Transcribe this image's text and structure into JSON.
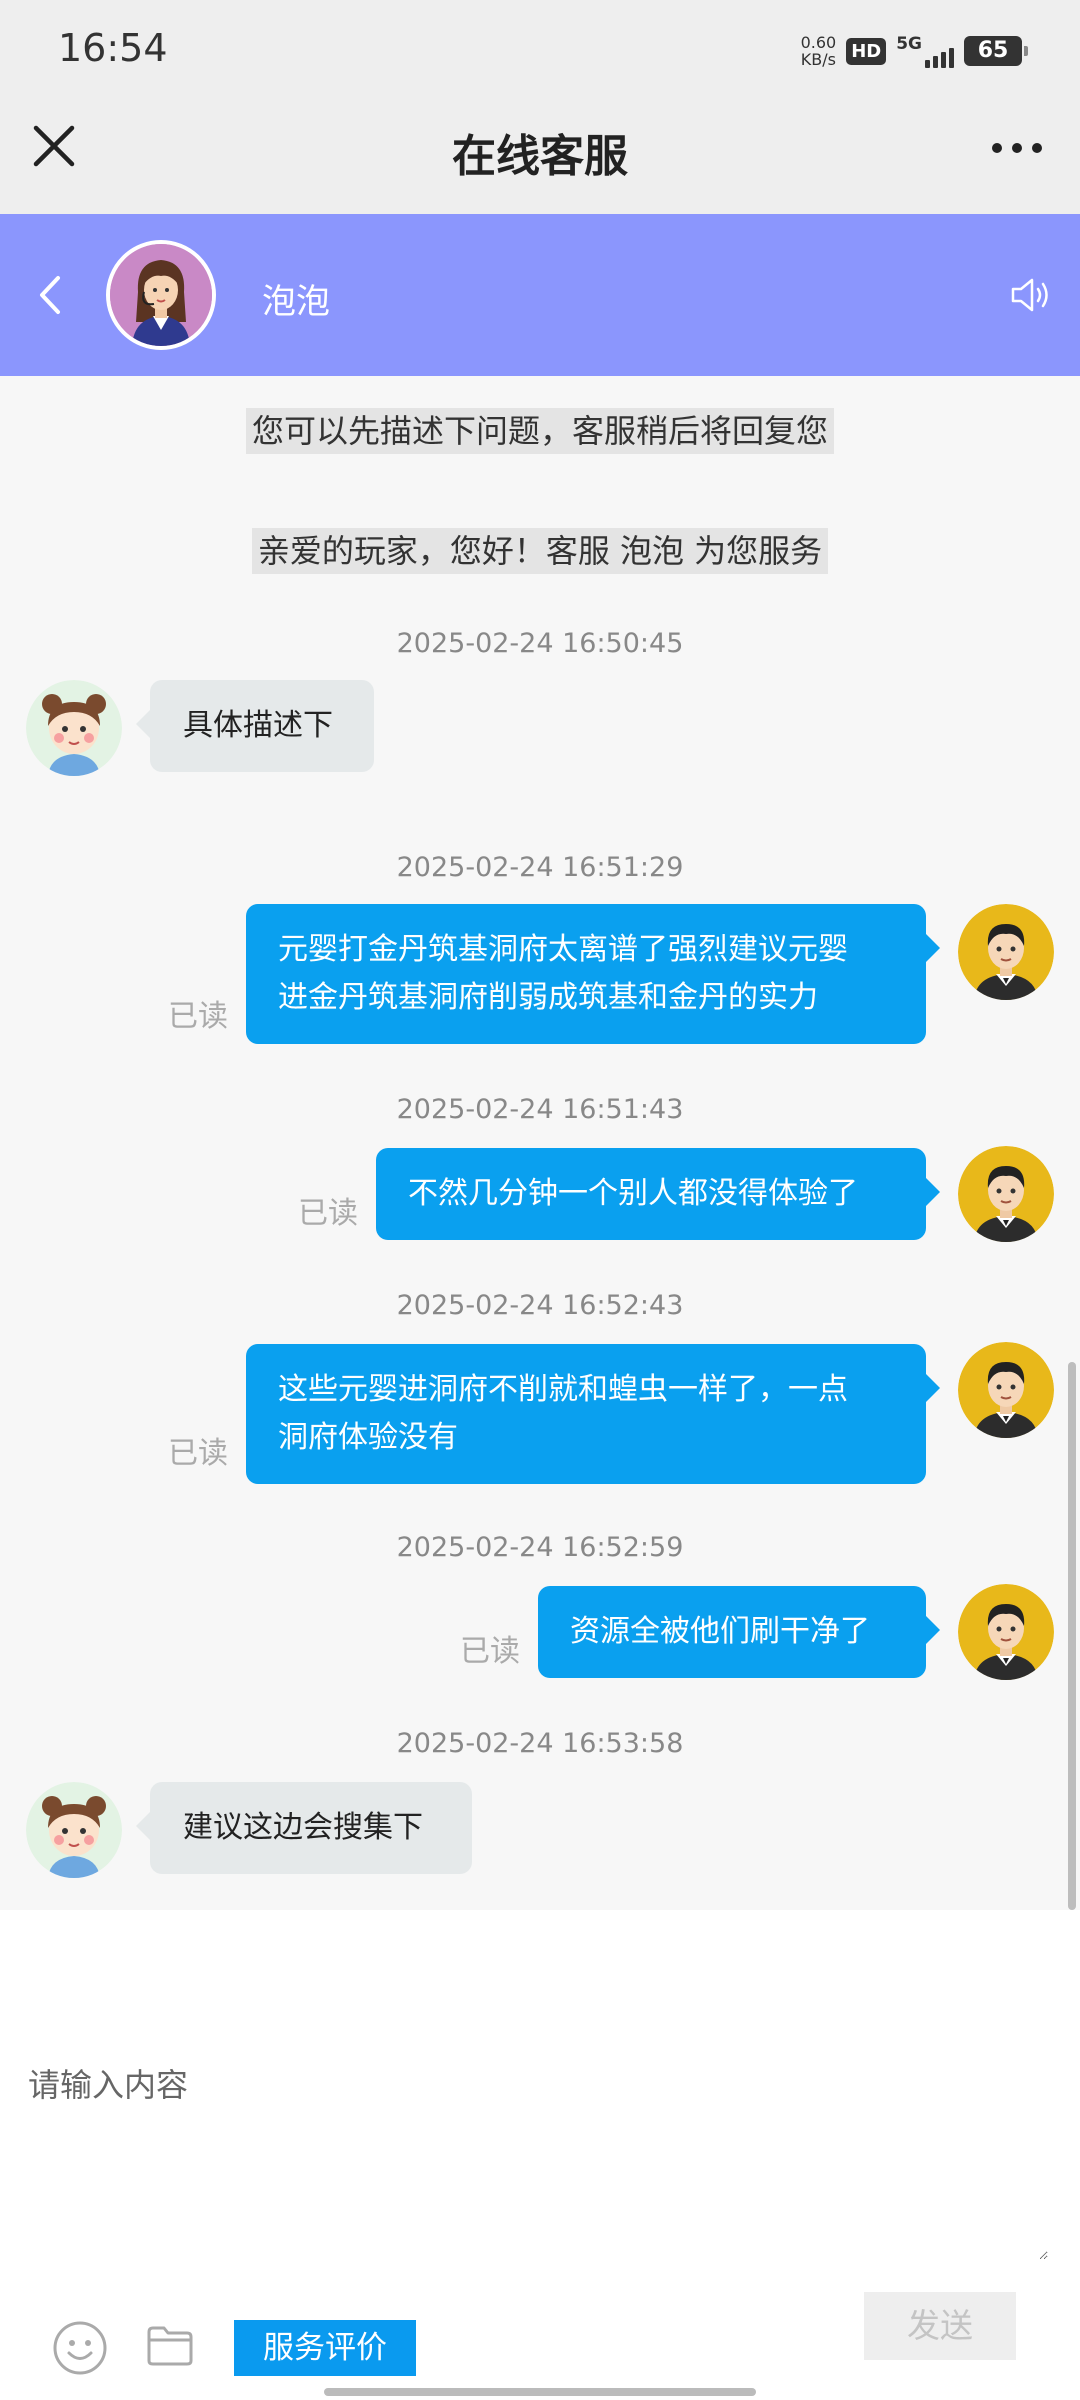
{
  "status_bar": {
    "time": "16:54",
    "net_speed_value": "0.60",
    "net_speed_unit": "KB/s",
    "hd": "HD",
    "network": "5G",
    "battery": "65"
  },
  "title_bar": {
    "title": "在线客服",
    "close_icon": "close-icon",
    "more_icon": "more-dots-icon"
  },
  "agent": {
    "name": "泡泡",
    "back_icon": "back-chevron-icon",
    "speaker_icon": "speaker-icon",
    "header_color": "#8b96fd"
  },
  "chat": {
    "system_notes": [
      "您可以先描述下问题，客服稍后将回复您",
      "亲爱的玩家，您好！客服 泡泡 为您服务"
    ],
    "messages": [
      {
        "time": "2025-02-24 16:50:45",
        "side": "incoming",
        "lines": [
          "具体描述下"
        ]
      },
      {
        "time": "2025-02-24 16:51:29",
        "side": "outgoing",
        "status": "已读",
        "lines": [
          "元婴打金丹筑基洞府太离谱了强烈建议元婴",
          "进金丹筑基洞府削弱成筑基和金丹的实力"
        ]
      },
      {
        "time": "2025-02-24 16:51:43",
        "side": "outgoing",
        "status": "已读",
        "lines": [
          "不然几分钟一个别人都没得体验了"
        ]
      },
      {
        "time": "2025-02-24 16:52:43",
        "side": "outgoing",
        "status": "已读",
        "lines": [
          "这些元婴进洞府不削就和蝗虫一样了，一点",
          "洞府体验没有"
        ]
      },
      {
        "time": "2025-02-24 16:52:59",
        "side": "outgoing",
        "status": "已读",
        "lines": [
          "资源全被他们刷干净了"
        ]
      },
      {
        "time": "2025-02-24 16:53:58",
        "side": "incoming",
        "lines": [
          "建议这边会搜集下"
        ]
      }
    ],
    "outgoing_color": "#0aa0ef",
    "incoming_color": "#e5e9ea"
  },
  "input": {
    "placeholder": "请输入内容",
    "rating_label": "服务评价",
    "send_label": "发送",
    "emoji_icon": "emoji-icon",
    "folder_icon": "folder-icon"
  }
}
